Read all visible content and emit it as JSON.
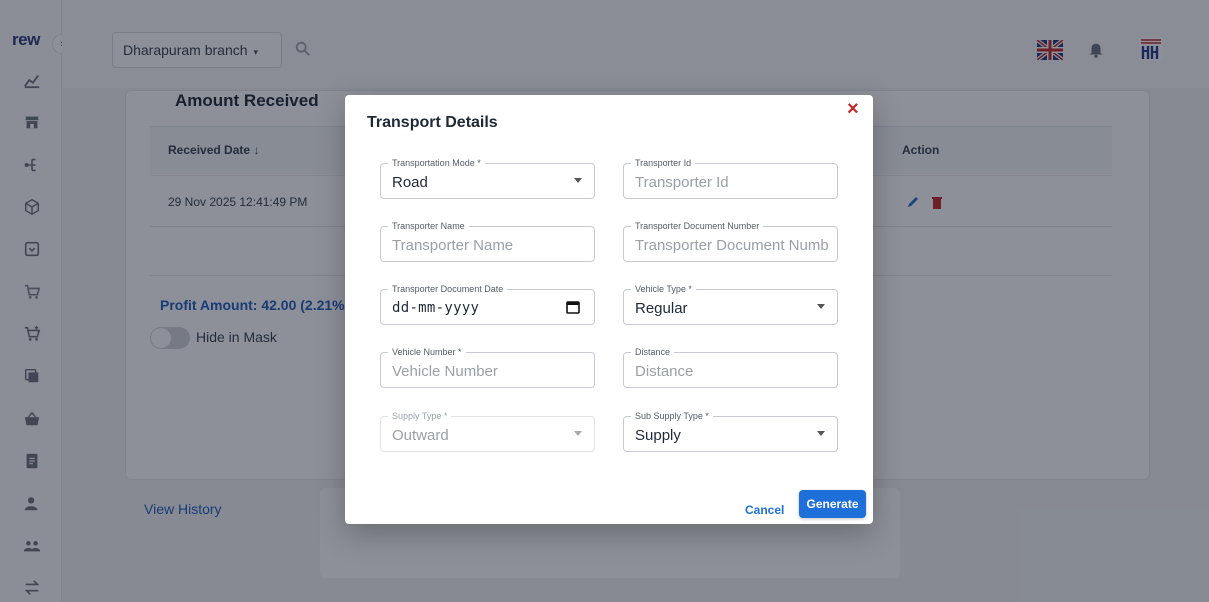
{
  "sidebar": {
    "logo": "rew",
    "collapse": "›",
    "items": [
      "dashboard-icon",
      "store-icon",
      "hierarchy-icon",
      "box-icon",
      "package-icon",
      "cart-icon",
      "cart-add-icon",
      "copy-icon",
      "basket-icon",
      "document-icon",
      "user-icon",
      "users-icon",
      "transfer-icon"
    ]
  },
  "header": {
    "branch": "Dharapuram branch",
    "caret": "▾"
  },
  "page": {
    "section_title": "Amount Received",
    "columns": {
      "received_date": "Received Date ↓",
      "action": "Action"
    },
    "rows": [
      {
        "received_date": "29 Nov 2025 12:41:49 PM"
      }
    ],
    "profit_label": "Profit Amount: 42.00 (2.21%",
    "hide_in_mask": "Hide in Mask",
    "view_history": "View History"
  },
  "modal": {
    "title": "Transport Details",
    "close": "×",
    "fields": {
      "transportation_mode": {
        "label": "Transportation Mode *",
        "value": "Road"
      },
      "transporter_id": {
        "label": "Transporter Id",
        "placeholder": "Transporter Id"
      },
      "transporter_name": {
        "label": "Transporter Name",
        "placeholder": "Transporter Name"
      },
      "transporter_doc_number": {
        "label": "Transporter Document Number",
        "placeholder": "Transporter Document Numb"
      },
      "transporter_doc_date": {
        "label": "Transporter Document Date",
        "value": "dd-mm-yyyy"
      },
      "vehicle_type": {
        "label": "Vehicle Type *",
        "value": "Regular"
      },
      "vehicle_number": {
        "label": "Vehicle Number *",
        "placeholder": "Vehicle Number"
      },
      "distance": {
        "label": "Distance",
        "placeholder": "Distance"
      },
      "supply_type": {
        "label": "Supply Type *",
        "value": "Outward"
      },
      "sub_supply_type": {
        "label": "Sub Supply Type *",
        "value": "Supply"
      }
    },
    "cancel_label": "Cancel",
    "generate_label": "Generate"
  },
  "colors": {
    "primary": "#1e6fd9",
    "close": "#c62828",
    "sidebar_icon": "#6b7280"
  }
}
